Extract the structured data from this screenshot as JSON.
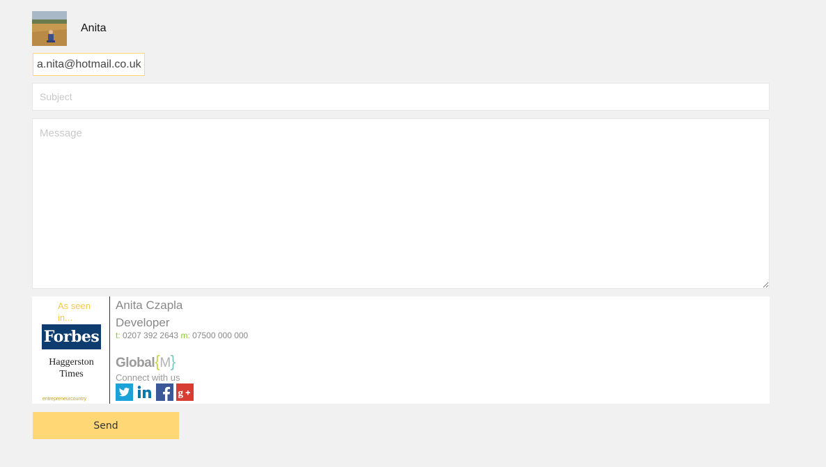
{
  "user": {
    "name": "Anita"
  },
  "recipient": {
    "email": "a.nita@hotmail.co.uk"
  },
  "form": {
    "subject_placeholder": "Subject",
    "message_placeholder": "Message",
    "send_label": "Send"
  },
  "signature": {
    "as_seen_in": "As seen in...",
    "press": {
      "forbes": "Forbes",
      "haggerston": "Haggerston Times",
      "entrepreneur": "entrepreneurcountry"
    },
    "name": "Anita Czapla",
    "title": "Developer",
    "phone_label": "t:",
    "phone": "0207 392 2643",
    "mobile_label": "m:",
    "mobile": "07500 000 000",
    "company": {
      "word": "Global",
      "brace_open": "{",
      "letter": "M",
      "brace_close": "}"
    },
    "connect_text": "Connect with us",
    "social": [
      {
        "icon": "twitter-icon",
        "color": "#1da1d9"
      },
      {
        "icon": "linkedin-icon",
        "color": "#0a7aad"
      },
      {
        "icon": "facebook-icon",
        "color": "#3b5998"
      },
      {
        "icon": "google-plus-icon",
        "color": "#d73d32"
      }
    ]
  },
  "colors": {
    "accent": "#ffd775",
    "background": "#f1f1f1",
    "phone_label": "#8dc63f"
  }
}
